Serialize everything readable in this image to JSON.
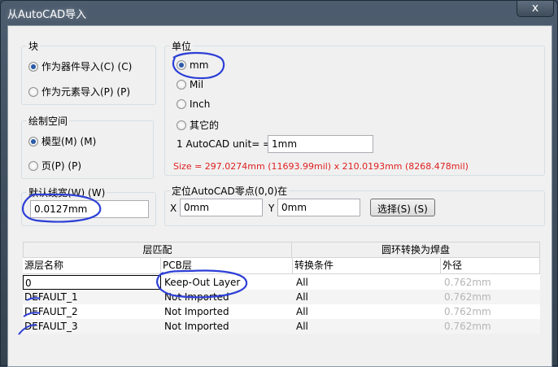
{
  "window": {
    "title": "从AutoCAD导入",
    "close_glyph": "x"
  },
  "block_group": {
    "legend": "块",
    "options": [
      {
        "label": "作为器件导入(C) (C)",
        "checked": true
      },
      {
        "label": "作为元素导入(P) (P)",
        "checked": false
      }
    ]
  },
  "space_group": {
    "legend": "绘制空间",
    "options": [
      {
        "label": "模型(M) (M)",
        "checked": true
      },
      {
        "label": "页(P) (P)",
        "checked": false
      }
    ]
  },
  "linewidth_group": {
    "legend": "默认线宽(W) (W)",
    "value": "0.0127mm"
  },
  "units_group": {
    "legend": "单位",
    "options": [
      {
        "label": "mm",
        "checked": true
      },
      {
        "label": "Mil",
        "checked": false
      },
      {
        "label": "Inch",
        "checked": false
      },
      {
        "label": "其它的",
        "checked": false
      }
    ],
    "unit_label": "1 AutoCAD unit= =",
    "unit_value": "1mm",
    "size_text": "Size = 297.0274mm (11693.99mil) x 210.0193mm (8268.478mil)",
    "size_color": "#e02020"
  },
  "origin_group": {
    "legend": "定位AutoCAD零点(0,0)在",
    "x_label": "X",
    "x_value": "0mm",
    "y_label": "Y",
    "y_value": "0mm",
    "select_button": "选择(S) (S)"
  },
  "table": {
    "group_headers": [
      "层匹配",
      "圆环转换为焊盘"
    ],
    "columns": [
      "源层名称",
      "PCB层",
      "转换条件",
      "外径"
    ],
    "rows": [
      [
        "0",
        "Keep-Out Layer",
        "All",
        "0.762mm"
      ],
      [
        "DEFAULT_1",
        "Not Imported",
        "All",
        "0.762mm"
      ],
      [
        "DEFAULT_2",
        "Not Imported",
        "All",
        "0.762mm"
      ],
      [
        "DEFAULT_3",
        "Not Imported",
        "All",
        "0.762mm"
      ]
    ]
  },
  "annotation_color": "#2c3fd6"
}
